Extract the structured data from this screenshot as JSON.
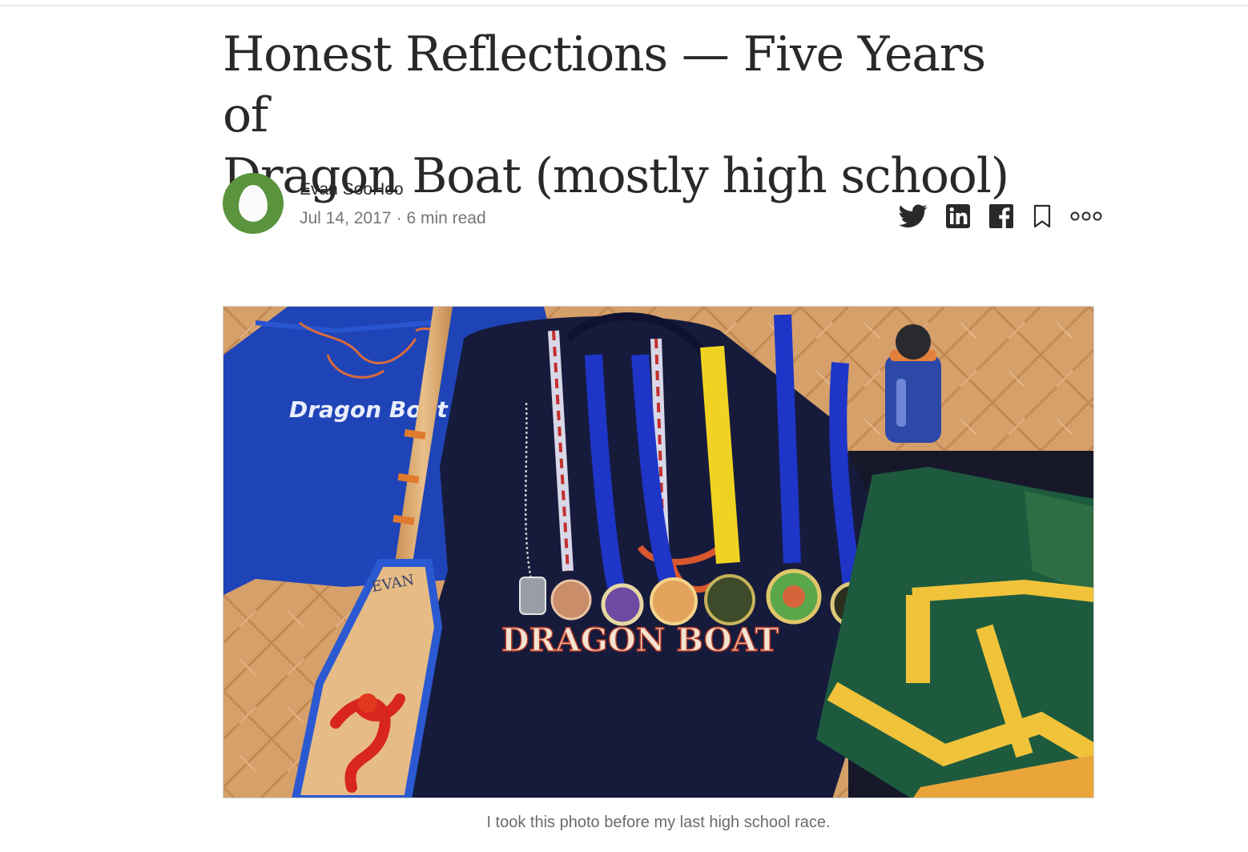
{
  "article": {
    "title_line1": "Honest Reflections — Five Years of",
    "title_line2": "Dragon Boat (mostly high school)",
    "author": "Evan SooHoo",
    "date": "Jul 14, 2017",
    "separator": "·",
    "read_time": "6 min read",
    "avatar_color": "#5a943d"
  },
  "share": {
    "icons": [
      "twitter-icon",
      "linkedin-icon",
      "facebook-icon",
      "bookmark-icon",
      "more-options-icon"
    ],
    "icon_color": "#292929"
  },
  "figure": {
    "image_text_sweatshirt": "Dragon Boat",
    "image_text_paddle": "EVAN",
    "image_text_hoodie": "DRAGON BOAT",
    "caption": "I took this photo before my last high school race."
  }
}
